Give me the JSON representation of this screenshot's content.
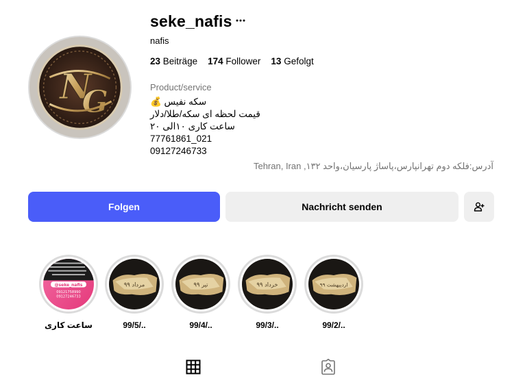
{
  "profile": {
    "username": "seke_nafis",
    "full_name": "nafis",
    "stats": {
      "posts_count": "23",
      "posts_label": "Beiträge",
      "followers_count": "174",
      "followers_label": "Follower",
      "following_count": "13",
      "following_label": "Gefolgt"
    },
    "category": "Product/service",
    "bio": [
      "سکه نفیس 💰",
      "قیمت لحظه ای سکه/طلا/دلار",
      "ساعت کاری ۱۰الی ۲۰",
      "77761861_021",
      "09127246733"
    ],
    "address": "آدرس:فلکه دوم تهرانپارس،پاساژ پارسیان،واحد ۱۳۲, Tehran, Iran"
  },
  "actions": {
    "follow_label": "Folgen",
    "message_label": "Nachricht senden",
    "suggest_icon": "person-add-icon"
  },
  "highlights": [
    {
      "label": "ساعت کاری",
      "cover_handle": "@seke_nafis",
      "cover_phone1": "09121758990",
      "cover_phone2": "09127246733"
    },
    {
      "label": "99/5/..",
      "cover_text": "مرداد ۹۹"
    },
    {
      "label": "99/4/..",
      "cover_text": "تیر ۹۹"
    },
    {
      "label": "99/3/..",
      "cover_text": "خرداد ۹۹"
    },
    {
      "label": "99/2/..",
      "cover_text": "اردیبهشت ۹۹"
    }
  ],
  "tabs": [
    {
      "icon": "grid-icon"
    },
    {
      "icon": "tagged-icon"
    }
  ],
  "colors": {
    "accent": "#4a5df9",
    "secondary_bg": "#efefef",
    "muted_text": "#737373",
    "ring": "#dbdbdb"
  }
}
